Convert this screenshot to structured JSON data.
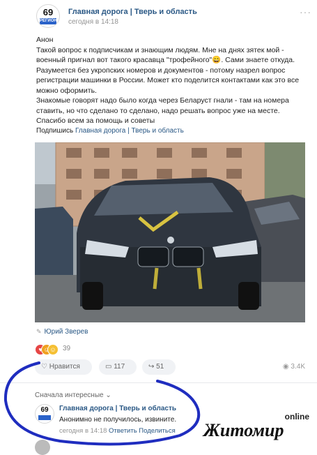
{
  "post": {
    "author": "Главная дорога | Тверь и область",
    "time": "сегодня в 14:18",
    "avatar": {
      "number": "69",
      "region": "РЕГИОН"
    },
    "more_icon": "ellipsis-icon",
    "text": [
      "Анон",
      "Такой вопрос к подписчикам и знающим людям. Мне на днях зятек мой - военный пригнал вот такого красавца \"трофейного\"😄. Сами знаете откуда. Разумеется без укропских номеров и документов - потому назрел вопрос регистрации машинки в России. Может кто поделится контактами как это все можно оформить.",
      "Знакомые говорят надо было когда через Беларуст гнали - там на номера ставить, но что сделано то сделано, надо решать вопрос уже на месте. Спасибо всем за помощь и советы"
    ],
    "subscribe_label": "Подпишись",
    "subscribe_link": "Главная дорога | Тверь и область",
    "signature": "Юрий Зверев"
  },
  "reactions": {
    "icons": [
      "heart-icon",
      "laugh-icon",
      "smile-icon"
    ],
    "count": "39"
  },
  "actions": {
    "like_label": "Нравится",
    "comments_count": "117",
    "shares_count": "51",
    "views": "3.4K"
  },
  "comments": {
    "sort_label": "Сначала интересные",
    "items": [
      {
        "author": "Главная дорога | Тверь и область",
        "text": "Анонимно не получилось, извините.",
        "time": "сегодня в 14:18",
        "reply_label": "Ответить",
        "share_label": "Поделиться",
        "avatar_number": "69"
      }
    ]
  },
  "watermark": {
    "top": "online",
    "main": "Житомир"
  },
  "colors": {
    "link": "#2a5885",
    "circle": "#1f2dbf",
    "reaction_heart": "#e64646"
  }
}
